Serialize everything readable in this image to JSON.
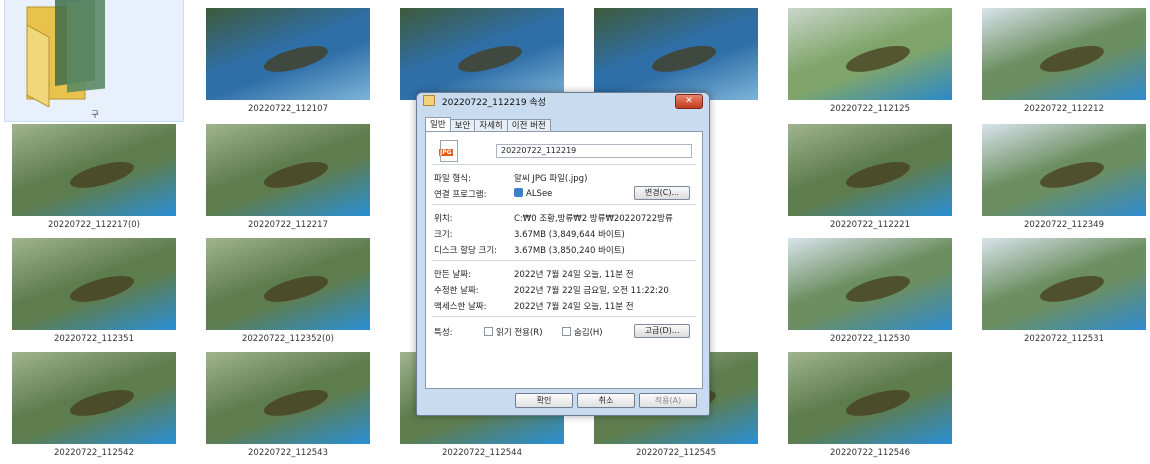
{
  "folder": {
    "label": "구"
  },
  "files": [
    {
      "name": "20220722_112107",
      "tone": "net"
    },
    {
      "name": "",
      "tone": "net"
    },
    {
      "name": "",
      "tone": "net"
    },
    {
      "name": "20220722_112125",
      "tone": "dock"
    },
    {
      "name": "20220722_112212",
      "tone": "lake"
    },
    {
      "name": "20220722_112217(0)",
      "tone": "green"
    },
    {
      "name": "20220722_112217",
      "tone": "green"
    },
    {
      "name": "20220722_112221",
      "tone": "green"
    },
    {
      "name": "20220722_112349",
      "tone": "lake"
    },
    {
      "name": "20220722_112351",
      "tone": "green"
    },
    {
      "name": "20220722_112352(0)",
      "tone": "green"
    },
    {
      "name": "20220722_112530",
      "tone": "lake"
    },
    {
      "name": "20220722_112531",
      "tone": "lake"
    },
    {
      "name": "20220722_112542",
      "tone": "green"
    },
    {
      "name": "20220722_112543",
      "tone": "green"
    },
    {
      "name": "20220722_112544",
      "tone": "green"
    },
    {
      "name": "20220722_112545",
      "tone": "green"
    },
    {
      "name": "20220722_112546",
      "tone": "green"
    }
  ],
  "dialog": {
    "title": "20220722_112219 속성",
    "close": "✕",
    "tabs": [
      "일반",
      "보안",
      "자세히",
      "이전 버전"
    ],
    "icon_label": "JPG",
    "filename": "20220722_112219",
    "rows": {
      "file_type_label": "파일 형식:",
      "file_type_value": "알씨 JPG 파일(.jpg)",
      "open_with_label": "연결 프로그램:",
      "open_with_value": "ALSee",
      "change_button": "변경(C)...",
      "location_label": "위치:",
      "location_value": "C:₩0 조황,방류₩2 방류₩20220722방류",
      "size_label": "크기:",
      "size_value": "3.67MB (3,849,644 바이트)",
      "disk_size_label": "디스크 할당 크기:",
      "disk_size_value": "3.67MB (3,850,240 바이트)",
      "created_label": "만든 날짜:",
      "created_value": "2022년 7월 24일 오늘, 11분 전",
      "modified_label": "수정한 날짜:",
      "modified_value": "2022년 7월 22일 금요일, 오전 11:22:20",
      "accessed_label": "액세스한 날짜:",
      "accessed_value": "2022년 7월 24일 오늘, 11분 전",
      "attributes_label": "특성:",
      "readonly_label": "읽기 전용(R)",
      "hidden_label": "숨김(H)",
      "advanced_button": "고급(D)..."
    },
    "ok": "확인",
    "cancel": "취소",
    "apply": "적용(A)"
  }
}
